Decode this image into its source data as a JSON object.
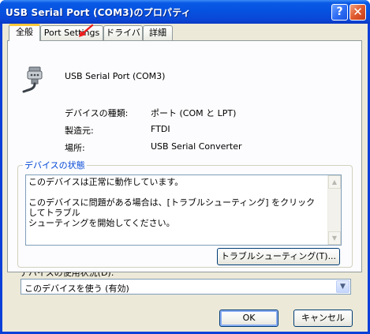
{
  "window": {
    "title": "USB Serial Port (COM3)のプロパティ"
  },
  "title_buttons": {
    "help": "?",
    "close": "✕"
  },
  "tabs": [
    {
      "label": "全般",
      "active": true
    },
    {
      "label": "Port Settings",
      "active": false
    },
    {
      "label": "ドライバ",
      "active": false
    },
    {
      "label": "詳細",
      "active": false
    }
  ],
  "device": {
    "name": "USB Serial Port (COM3)",
    "icon": "serial-port-icon"
  },
  "properties": [
    {
      "label": "デバイスの種類:",
      "value": "ポート (COM と LPT)"
    },
    {
      "label": "製造元:",
      "value": "FTDI"
    },
    {
      "label": "場所:",
      "value": "USB Serial Converter"
    }
  ],
  "status_group": {
    "title": "デバイスの状態",
    "text": "このデバイスは正常に動作しています。\n\nこのデバイスに問題がある場合は、[トラブルシューティング] をクリックしてトラブル\nシューティングを開始してください。",
    "troubleshoot_button": "トラブルシューティング(T)..."
  },
  "usage": {
    "label": "デバイスの使用状況(D):",
    "selected": "このデバイスを使う (有効)"
  },
  "footer": {
    "ok": "OK",
    "cancel": "キャンセル"
  },
  "colors": {
    "titlebar": "#0552e0",
    "dialog_bg": "#ece9d8",
    "group_title": "#0046d5",
    "annotation_arrow": "#ee1c1c"
  }
}
